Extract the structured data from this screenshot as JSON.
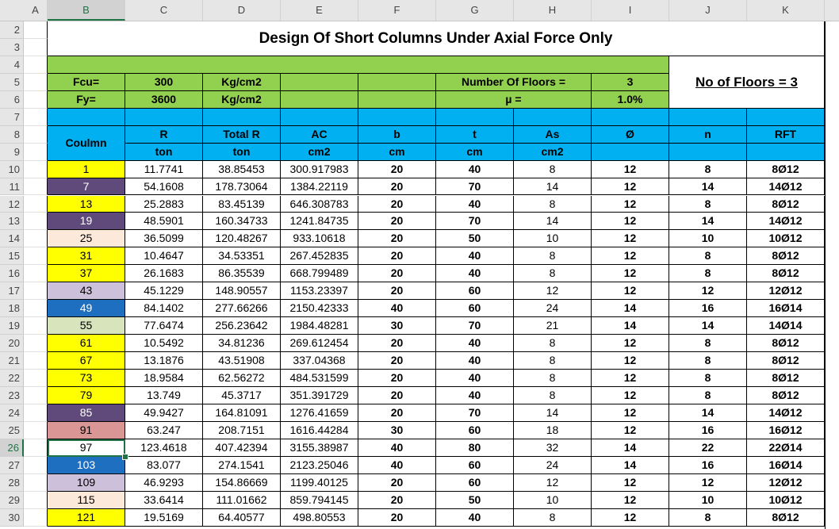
{
  "columns": [
    "A",
    "B",
    "C",
    "D",
    "E",
    "F",
    "G",
    "H",
    "I",
    "J",
    "K"
  ],
  "rows": [
    "2",
    "3",
    "4",
    "5",
    "6",
    "7",
    "8",
    "9",
    "10",
    "11",
    "12",
    "13",
    "14",
    "15",
    "16",
    "17",
    "18",
    "19",
    "20",
    "21",
    "22",
    "23",
    "24",
    "25",
    "26",
    "27",
    "28",
    "29",
    "30"
  ],
  "selected": {
    "column": "B",
    "row": "26"
  },
  "title": "Design Of Short Columns Under Axial Force Only",
  "params": {
    "fcu_label": "Fcu=",
    "fcu_value": "300",
    "fcu_unit": "Kg/cm2",
    "fy_label": "Fy=",
    "fy_value": "3600",
    "fy_unit": "Kg/cm2",
    "floors_label": "Number Of Floors =",
    "floors_value": "3",
    "mu_label": "µ =",
    "mu_value": "1.0%",
    "floors_box": "No of Floors = 3"
  },
  "headers": {
    "column": "Coulmn",
    "R": "R",
    "R_unit": "ton",
    "TotalR": "Total R",
    "TotalR_unit": "ton",
    "AC": "AC",
    "AC_unit": "cm2",
    "b": "b",
    "b_unit": "cm",
    "t": "t",
    "t_unit": "cm",
    "As": "As",
    "As_unit": "cm2",
    "phi": "Ø",
    "n": "n",
    "RFT": "RFT"
  },
  "colors": {
    "yellow": "#ffff00",
    "purple": "#604a7b",
    "peach": "#fde9d9",
    "lavender": "#ccc0da",
    "steelblue": "#1f6fc0",
    "sage": "#d8e4bc",
    "rose": "#da9694",
    "white": "#ffffff",
    "green": "#92d050",
    "cyan": "#00b0f0"
  },
  "data": [
    {
      "col": "1",
      "color": "yellow",
      "R": "11.7741",
      "TotalR": "38.85453",
      "AC": "300.917983",
      "b": "20",
      "t": "40",
      "As": "8",
      "phi": "12",
      "n": "8",
      "RFT": "8Ø12"
    },
    {
      "col": "7",
      "color": "purple",
      "R": "54.1608",
      "TotalR": "178.73064",
      "AC": "1384.22119",
      "b": "20",
      "t": "70",
      "As": "14",
      "phi": "12",
      "n": "14",
      "RFT": "14Ø12"
    },
    {
      "col": "13",
      "color": "yellow",
      "R": "25.2883",
      "TotalR": "83.45139",
      "AC": "646.308783",
      "b": "20",
      "t": "40",
      "As": "8",
      "phi": "12",
      "n": "8",
      "RFT": "8Ø12"
    },
    {
      "col": "19",
      "color": "purple",
      "R": "48.5901",
      "TotalR": "160.34733",
      "AC": "1241.84735",
      "b": "20",
      "t": "70",
      "As": "14",
      "phi": "12",
      "n": "14",
      "RFT": "14Ø12"
    },
    {
      "col": "25",
      "color": "peach",
      "R": "36.5099",
      "TotalR": "120.48267",
      "AC": "933.10618",
      "b": "20",
      "t": "50",
      "As": "10",
      "phi": "12",
      "n": "10",
      "RFT": "10Ø12"
    },
    {
      "col": "31",
      "color": "yellow",
      "R": "10.4647",
      "TotalR": "34.53351",
      "AC": "267.452835",
      "b": "20",
      "t": "40",
      "As": "8",
      "phi": "12",
      "n": "8",
      "RFT": "8Ø12"
    },
    {
      "col": "37",
      "color": "yellow",
      "R": "26.1683",
      "TotalR": "86.35539",
      "AC": "668.799489",
      "b": "20",
      "t": "40",
      "As": "8",
      "phi": "12",
      "n": "8",
      "RFT": "8Ø12"
    },
    {
      "col": "43",
      "color": "lavender",
      "R": "45.1229",
      "TotalR": "148.90557",
      "AC": "1153.23397",
      "b": "20",
      "t": "60",
      "As": "12",
      "phi": "12",
      "n": "12",
      "RFT": "12Ø12"
    },
    {
      "col": "49",
      "color": "steelblue",
      "R": "84.1402",
      "TotalR": "277.66266",
      "AC": "2150.42333",
      "b": "40",
      "t": "60",
      "As": "24",
      "phi": "14",
      "n": "16",
      "RFT": "16Ø14"
    },
    {
      "col": "55",
      "color": "sage",
      "R": "77.6474",
      "TotalR": "256.23642",
      "AC": "1984.48281",
      "b": "30",
      "t": "70",
      "As": "21",
      "phi": "14",
      "n": "14",
      "RFT": "14Ø14"
    },
    {
      "col": "61",
      "color": "yellow",
      "R": "10.5492",
      "TotalR": "34.81236",
      "AC": "269.612454",
      "b": "20",
      "t": "40",
      "As": "8",
      "phi": "12",
      "n": "8",
      "RFT": "8Ø12"
    },
    {
      "col": "67",
      "color": "yellow",
      "R": "13.1876",
      "TotalR": "43.51908",
      "AC": "337.04368",
      "b": "20",
      "t": "40",
      "As": "8",
      "phi": "12",
      "n": "8",
      "RFT": "8Ø12"
    },
    {
      "col": "73",
      "color": "yellow",
      "R": "18.9584",
      "TotalR": "62.56272",
      "AC": "484.531599",
      "b": "20",
      "t": "40",
      "As": "8",
      "phi": "12",
      "n": "8",
      "RFT": "8Ø12"
    },
    {
      "col": "79",
      "color": "yellow",
      "R": "13.749",
      "TotalR": "45.3717",
      "AC": "351.391729",
      "b": "20",
      "t": "40",
      "As": "8",
      "phi": "12",
      "n": "8",
      "RFT": "8Ø12"
    },
    {
      "col": "85",
      "color": "purple",
      "R": "49.9427",
      "TotalR": "164.81091",
      "AC": "1276.41659",
      "b": "20",
      "t": "70",
      "As": "14",
      "phi": "12",
      "n": "14",
      "RFT": "14Ø12"
    },
    {
      "col": "91",
      "color": "rose",
      "R": "63.247",
      "TotalR": "208.7151",
      "AC": "1616.44284",
      "b": "30",
      "t": "60",
      "As": "18",
      "phi": "12",
      "n": "16",
      "RFT": "16Ø12"
    },
    {
      "col": "97",
      "color": "white",
      "R": "123.4618",
      "TotalR": "407.42394",
      "AC": "3155.38987",
      "b": "40",
      "t": "80",
      "As": "32",
      "phi": "14",
      "n": "22",
      "RFT": "22Ø14"
    },
    {
      "col": "103",
      "color": "steelblue",
      "R": "83.077",
      "TotalR": "274.1541",
      "AC": "2123.25046",
      "b": "40",
      "t": "60",
      "As": "24",
      "phi": "14",
      "n": "16",
      "RFT": "16Ø14"
    },
    {
      "col": "109",
      "color": "lavender",
      "R": "46.9293",
      "TotalR": "154.86669",
      "AC": "1199.40125",
      "b": "20",
      "t": "60",
      "As": "12",
      "phi": "12",
      "n": "12",
      "RFT": "12Ø12"
    },
    {
      "col": "115",
      "color": "peach",
      "R": "33.6414",
      "TotalR": "111.01662",
      "AC": "859.794145",
      "b": "20",
      "t": "50",
      "As": "10",
      "phi": "12",
      "n": "10",
      "RFT": "10Ø12"
    },
    {
      "col": "121",
      "color": "yellow",
      "R": "19.5169",
      "TotalR": "64.40577",
      "AC": "498.80553",
      "b": "20",
      "t": "40",
      "As": "8",
      "phi": "12",
      "n": "8",
      "RFT": "8Ø12"
    }
  ]
}
